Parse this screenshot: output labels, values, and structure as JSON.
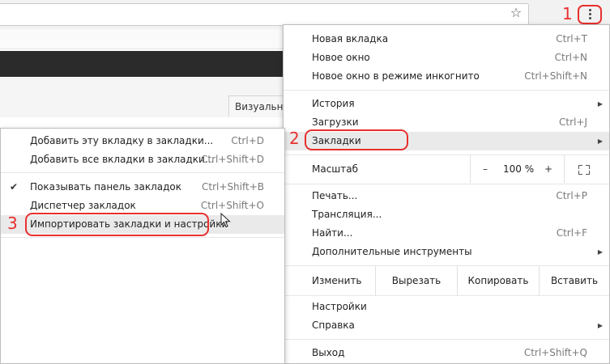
{
  "toolbar": {
    "star_icon": "star-icon",
    "menu_icon": "three-dots-vertical-icon"
  },
  "page": {
    "visual_tab_label": "Визуальн"
  },
  "badges": {
    "step1": "1",
    "step2": "2",
    "step3": "3"
  },
  "annotation_color": "#e8302e",
  "main_menu": {
    "new_tab": {
      "label": "Новая вкладка",
      "shortcut": "Ctrl+T"
    },
    "new_window": {
      "label": "Новое окно",
      "shortcut": "Ctrl+N"
    },
    "incognito": {
      "label": "Новое окно в режиме инкогнито",
      "shortcut": "Ctrl+Shift+N"
    },
    "history": {
      "label": "История"
    },
    "downloads": {
      "label": "Загрузки",
      "shortcut": "Ctrl+J"
    },
    "bookmarks": {
      "label": "Закладки"
    },
    "zoom": {
      "label": "Масштаб",
      "minus": "–",
      "value": "100 %",
      "plus": "+"
    },
    "print": {
      "label": "Печать...",
      "shortcut": "Ctrl+P"
    },
    "cast": {
      "label": "Трансляция..."
    },
    "find": {
      "label": "Найти...",
      "shortcut": "Ctrl+F"
    },
    "more_tools": {
      "label": "Дополнительные инструменты"
    },
    "edit": {
      "label": "Изменить",
      "cut": "Вырезать",
      "copy": "Копировать",
      "paste": "Вставить"
    },
    "settings": {
      "label": "Настройки"
    },
    "help": {
      "label": "Справка"
    },
    "exit": {
      "label": "Выход",
      "shortcut": "Ctrl+Shift+Q"
    }
  },
  "bookmarks_submenu": {
    "bookmark_tab": {
      "label": "Добавить эту вкладку в закладки...",
      "shortcut": "Ctrl+D"
    },
    "bookmark_all": {
      "label": "Добавить все вкладки в закладки...",
      "shortcut": "Ctrl+Shift+D"
    },
    "show_bar": {
      "label": "Показывать панель закладок",
      "shortcut": "Ctrl+Shift+B",
      "checked": true
    },
    "manager": {
      "label": "Диспетчер закладок",
      "shortcut": "Ctrl+Shift+O"
    },
    "import": {
      "label": "Импортировать закладки и настройки"
    }
  }
}
